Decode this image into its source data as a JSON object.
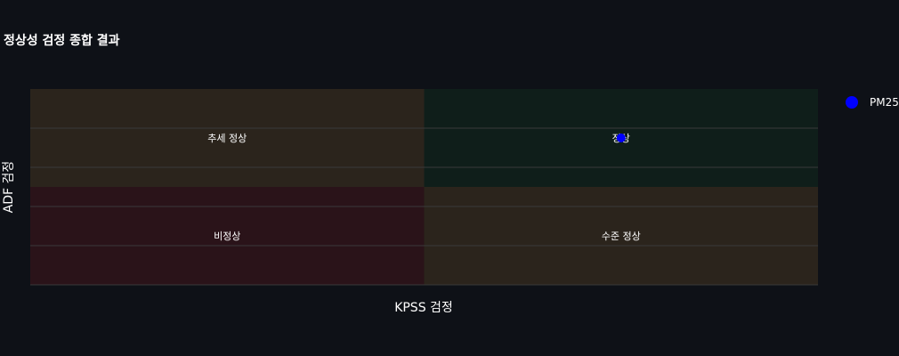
{
  "chart_data": {
    "type": "scatter",
    "title": "정상성 검정 종합 결과",
    "xlabel": "KPSS 검정",
    "ylabel": "ADF 검정",
    "xlim": [
      0,
      1
    ],
    "ylim": [
      0,
      1
    ],
    "grid": true,
    "legend_position": "top-right",
    "quadrants": [
      {
        "label": "추세 정상",
        "x_range": [
          0,
          0.5
        ],
        "y_range": [
          0.5,
          1
        ],
        "color": "#2b241c"
      },
      {
        "label": "정상",
        "x_range": [
          0.5,
          1
        ],
        "y_range": [
          0.5,
          1
        ],
        "color": "#0f1e1a"
      },
      {
        "label": "비정상",
        "x_range": [
          0,
          0.5
        ],
        "y_range": [
          0,
          0.5
        ],
        "color": "#2a1319"
      },
      {
        "label": "수준 정상",
        "x_range": [
          0.5,
          1
        ],
        "y_range": [
          0,
          0.5
        ],
        "color": "#2b241c"
      }
    ],
    "series": [
      {
        "name": "PM25",
        "color": "#0000ff",
        "points": [
          {
            "x": 0.75,
            "y": 0.75
          }
        ]
      }
    ]
  },
  "colors": {
    "background": "#0e1117",
    "text": "#ffffff",
    "grid": "#3a3a3a",
    "marker": "#0000ff"
  }
}
